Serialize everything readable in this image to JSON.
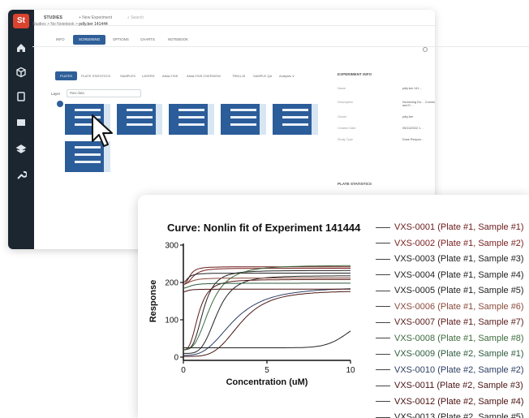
{
  "app": {
    "logo": "St",
    "top": {
      "section": "STUDIES",
      "new_experiment": "+ New Experiment",
      "search": "⌕ Search"
    },
    "breadcrumb": {
      "items": [
        "Studies",
        ">",
        "No Notebook",
        ">",
        "pdly.ber 141444"
      ]
    },
    "tabs": [
      "INFO",
      "SCREENING",
      "OPTIONS",
      "CHARTS",
      "NOTEBOOK"
    ],
    "active_tab": "SCREENING",
    "plate_tabs": [
      "PLATES",
      "PLATE STATISTICS",
      "SAMPLES",
      "LAYERS",
      "ANALYSIS",
      "ANALYSIS OVERVIEW",
      "TRELLIS",
      "SAMPLE QA",
      "Analysis ∨"
    ],
    "layer_label": "Layer",
    "layer_value": "Raw data",
    "experiment_info": {
      "title": "EXPERIMENT INFO",
      "rows": [
        {
          "key": "Name",
          "value": "pdly.ber 141…"
        },
        {
          "key": "Description",
          "value": "Screening Do… Curves and E…"
        },
        {
          "key": "Owner",
          "value": "pdly.ber"
        },
        {
          "key": "Created Date",
          "value": "05/13/2022 1…"
        },
        {
          "key": "Study Type",
          "value": "Dose Respon…"
        }
      ]
    },
    "plate_stats_title": "PLATE STATISTICS"
  },
  "chart_data": {
    "type": "line",
    "title": "Curve: Nonlin fit of Experiment 141444",
    "xlabel": "Concentration (uM)",
    "ylabel": "Response",
    "xlim": [
      0,
      10
    ],
    "ylim": [
      0,
      300
    ],
    "xticks": [
      0,
      5,
      10
    ],
    "yticks": [
      0,
      100,
      200,
      300
    ],
    "series": [
      {
        "name": "VXS-0001 (Plate #1, Sample #1)",
        "color": "#6b1a1a",
        "top": 242,
        "bottom": 195,
        "ec50": 0.4,
        "hill": 2.5
      },
      {
        "name": "VXS-0002 (Plate #1, Sample #2)",
        "color": "#7a1e1e",
        "top": 238,
        "bottom": 195,
        "ec50": 0.6,
        "hill": 2.5
      },
      {
        "name": "VXS-0003 (Plate #1, Sample #3)",
        "color": "#222222",
        "top": 232,
        "bottom": 20,
        "ec50": 1.2,
        "hill": 3.5
      },
      {
        "name": "VXS-0004 (Plate #1, Sample #4)",
        "color": "#222222",
        "top": 225,
        "bottom": 200,
        "ec50": 0.3,
        "hill": 2.0
      },
      {
        "name": "VXS-0005 (Plate #1, Sample #5)",
        "color": "#222222",
        "top": 218,
        "bottom": 10,
        "ec50": 2.0,
        "hill": 4.0
      },
      {
        "name": "VXS-0006 (Plate #1, Sample #6)",
        "color": "#8a4a3a",
        "top": 212,
        "bottom": 195,
        "ec50": 0.5,
        "hill": 2.0
      },
      {
        "name": "VXS-0007 (Plate #1, Sample #7)",
        "color": "#5a1a1a",
        "top": 208,
        "bottom": 20,
        "ec50": 0.9,
        "hill": 3.0
      },
      {
        "name": "VXS-0008 (Plate #1, Sample #8)",
        "color": "#3d6b3d",
        "top": 246,
        "bottom": 20,
        "ec50": 1.6,
        "hill": 3.0
      },
      {
        "name": "VXS-0009 (Plate #2, Sample #1)",
        "color": "#2d5a3d",
        "top": 198,
        "bottom": 185,
        "ec50": 0.5,
        "hill": 2.0
      },
      {
        "name": "VXS-0010 (Plate #2, Sample #2)",
        "color": "#2c3e63",
        "top": 188,
        "bottom": 5,
        "ec50": 3.0,
        "hill": 3.0
      },
      {
        "name": "VXS-0011 (Plate #2, Sample #3)",
        "color": "#4a1515",
        "top": 178,
        "bottom": 2,
        "ec50": 3.4,
        "hill": 4.0
      },
      {
        "name": "VXS-0012 (Plate #2, Sample #4)",
        "color": "#4a1010",
        "top": 182,
        "bottom": 175,
        "ec50": 0.3,
        "hill": 2.0
      },
      {
        "name": "VXS-0013 (Plate #2, Sample #5)",
        "color": "#222222",
        "top": 115,
        "bottom": 25,
        "ec50": 10.0,
        "hill": 14.0
      }
    ]
  }
}
